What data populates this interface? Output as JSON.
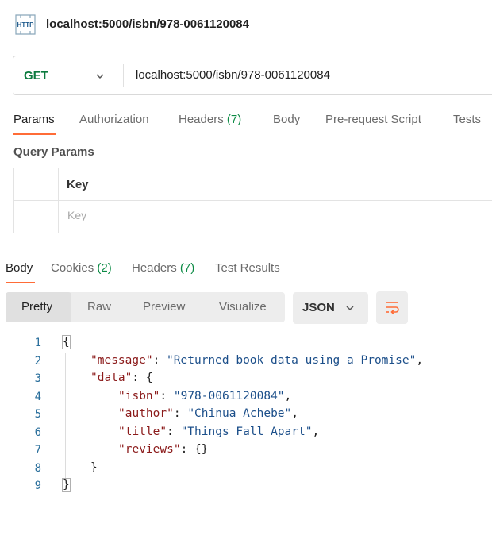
{
  "request": {
    "title": "localhost:5000/isbn/978-0061120084",
    "method": "GET",
    "url": "localhost:5000/isbn/978-0061120084"
  },
  "request_tabs": [
    {
      "label": "Params"
    },
    {
      "label": "Authorization"
    },
    {
      "label": "Headers",
      "count": "(7)"
    },
    {
      "label": "Body"
    },
    {
      "label": "Pre-request Script"
    },
    {
      "label": "Tests"
    }
  ],
  "params": {
    "section_label": "Query Params",
    "key_header": "Key",
    "key_placeholder": "Key"
  },
  "response_tabs": [
    {
      "label": "Body"
    },
    {
      "label": "Cookies",
      "count": "(2)"
    },
    {
      "label": "Headers",
      "count": "(7)"
    },
    {
      "label": "Test Results"
    }
  ],
  "view_modes": [
    "Pretty",
    "Raw",
    "Preview",
    "Visualize"
  ],
  "language": "JSON",
  "colors": {
    "accent": "#ff6c37",
    "method_get": "#0b7a3e",
    "count_green": "#0b8a44",
    "json_key": "#8b1a1a",
    "json_string": "#1c4f8a",
    "line_number": "#2a6f9c"
  },
  "icons": {
    "request_type": "http-icon",
    "method_dropdown": "chevron-down-icon",
    "language_dropdown": "chevron-down-icon",
    "wrap": "wrap-lines-icon"
  },
  "response_body": {
    "line_numbers": [
      "1",
      "2",
      "3",
      "4",
      "5",
      "6",
      "7",
      "8",
      "9"
    ],
    "open_brace": "{",
    "message_key": "\"message\"",
    "message_value": "\"Returned book data using a Promise\"",
    "data_key": "\"data\"",
    "isbn_key": "\"isbn\"",
    "isbn_value": "\"978-0061120084\"",
    "author_key": "\"author\"",
    "author_value": "\"Chinua Achebe\"",
    "title_key": "\"title\"",
    "title_value": "\"Things Fall Apart\"",
    "reviews_key": "\"reviews\"",
    "reviews_value": "{}",
    "inner_close": "}",
    "close_brace": "}"
  }
}
